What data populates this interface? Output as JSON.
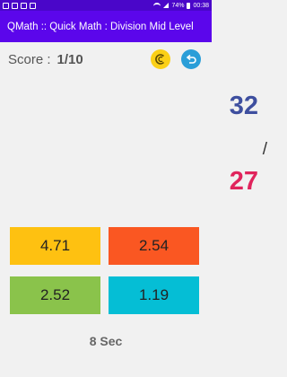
{
  "status_bar": {
    "battery": "74%",
    "time": "00:38"
  },
  "app_bar": {
    "title": "QMath :: Quick Math : Division Mid Level"
  },
  "score": {
    "label": "Score :",
    "value": "1/10"
  },
  "question": {
    "first": "32",
    "operator": "/",
    "second": "27"
  },
  "answers": [
    "4.71",
    "2.54",
    "2.52",
    "1.19"
  ],
  "timer": {
    "text": "8 Sec"
  },
  "colors": {
    "app_bar": "#5b06eb",
    "first_number": "#3e4f9f",
    "second_number": "#e0245c",
    "answer_1": "#fec111",
    "answer_2": "#fa5722",
    "answer_3": "#8ac34b",
    "answer_4": "#05bed5"
  },
  "icons": [
    "restart-icon",
    "back-icon"
  ]
}
